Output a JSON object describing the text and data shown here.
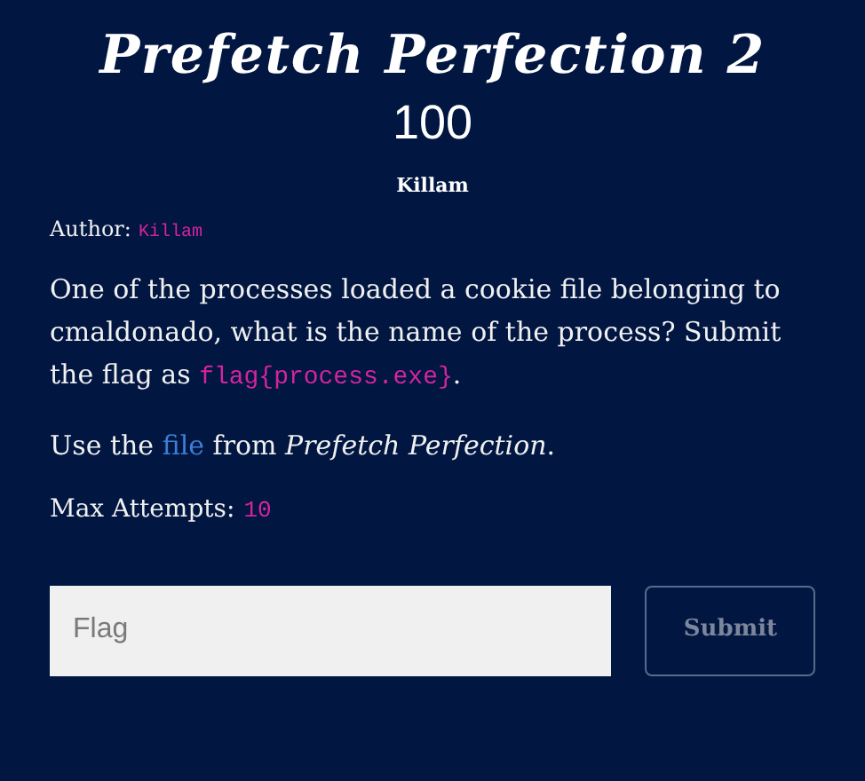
{
  "challenge": {
    "title": "Prefetch Perfection 2",
    "points": "100",
    "category": "Killam",
    "author_label": "Author:",
    "author": "Killam",
    "description": [
      [
        {
          "kind": "text",
          "text": "One of the processes loaded a cookie file belonging to cmaldonado, what is the name of the process? Submit the flag as "
        },
        {
          "kind": "code",
          "text": "flag{process.exe}"
        },
        {
          "kind": "text",
          "text": "."
        }
      ],
      [
        {
          "kind": "text",
          "text": "Use the "
        },
        {
          "kind": "link",
          "text": "file"
        },
        {
          "kind": "text",
          "text": " from "
        },
        {
          "kind": "italic",
          "text": "Prefetch Perfection"
        },
        {
          "kind": "text",
          "text": "."
        }
      ]
    ],
    "attempts_label": "Max Attempts:",
    "attempts": "10"
  },
  "form": {
    "flag_field": {
      "placeholder": "Flag"
    },
    "submit_button": "Submit"
  }
}
